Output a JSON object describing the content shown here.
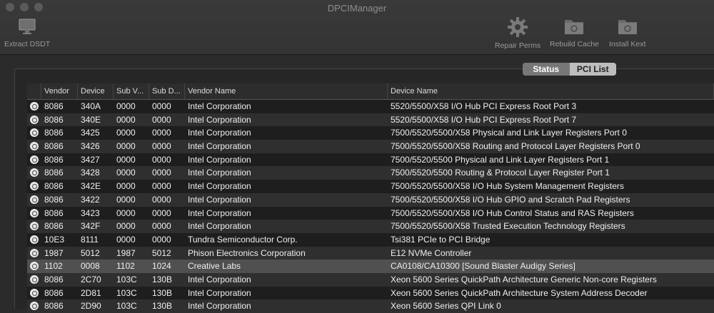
{
  "window": {
    "title": "DPCIManager"
  },
  "toolbar": {
    "extract_dsdt": "Extract DSDT",
    "repair_perms": "Repair Perms",
    "rebuild_cache": "Rebuild Cache",
    "install_kext": "Install Kext"
  },
  "segmented": {
    "status": "Status",
    "pci_list": "PCI List",
    "selected": "Status"
  },
  "table": {
    "columns": [
      "Vendor",
      "Device",
      "Sub V...",
      "Sub D...",
      "Vendor Name",
      "Device Name"
    ],
    "rows": [
      [
        "8086",
        "340A",
        "0000",
        "0000",
        "Intel Corporation",
        "5520/5500/X58 I/O Hub PCI Express Root Port 3"
      ],
      [
        "8086",
        "340E",
        "0000",
        "0000",
        "Intel Corporation",
        "5520/5500/X58 I/O Hub PCI Express Root Port 7"
      ],
      [
        "8086",
        "3425",
        "0000",
        "0000",
        "Intel Corporation",
        "7500/5520/5500/X58 Physical and Link Layer Registers Port 0"
      ],
      [
        "8086",
        "3426",
        "0000",
        "0000",
        "Intel Corporation",
        "7500/5520/5500/X58 Routing and Protocol Layer Registers Port 0"
      ],
      [
        "8086",
        "3427",
        "0000",
        "0000",
        "Intel Corporation",
        "7500/5520/5500 Physical and Link Layer Registers Port 1"
      ],
      [
        "8086",
        "3428",
        "0000",
        "0000",
        "Intel Corporation",
        "7500/5520/5500 Routing & Protocol Layer Register Port 1"
      ],
      [
        "8086",
        "342E",
        "0000",
        "0000",
        "Intel Corporation",
        "7500/5520/5500/X58 I/O Hub System Management Registers"
      ],
      [
        "8086",
        "3422",
        "0000",
        "0000",
        "Intel Corporation",
        "7500/5520/5500/X58 I/O Hub GPIO and Scratch Pad Registers"
      ],
      [
        "8086",
        "3423",
        "0000",
        "0000",
        "Intel Corporation",
        "7500/5520/5500/X58 I/O Hub Control Status and RAS Registers"
      ],
      [
        "8086",
        "342F",
        "0000",
        "0000",
        "Intel Corporation",
        "7500/5520/5500/X58 Trusted Execution Technology Registers"
      ],
      [
        "10E3",
        "8111",
        "0000",
        "0000",
        "Tundra Semiconductor Corp.",
        "Tsi381 PCIe to PCI Bridge"
      ],
      [
        "1987",
        "5012",
        "1987",
        "5012",
        "Phison Electronics Corporation",
        "E12 NVMe Controller"
      ],
      [
        "1102",
        "0008",
        "1102",
        "1024",
        "Creative Labs",
        "CA0108/CA10300 [Sound Blaster Audigy Series]"
      ],
      [
        "8086",
        "2C70",
        "103C",
        "130B",
        "Intel Corporation",
        "Xeon 5600 Series QuickPath Architecture Generic Non-core Registers"
      ],
      [
        "8086",
        "2D81",
        "103C",
        "130B",
        "Intel Corporation",
        "Xeon 5600 Series QuickPath Architecture System Address Decoder"
      ],
      [
        "8086",
        "2D90",
        "103C",
        "130B",
        "Intel Corporation",
        "Xeon 5600 Series QPI Link 0"
      ]
    ],
    "selected_row": 12
  }
}
